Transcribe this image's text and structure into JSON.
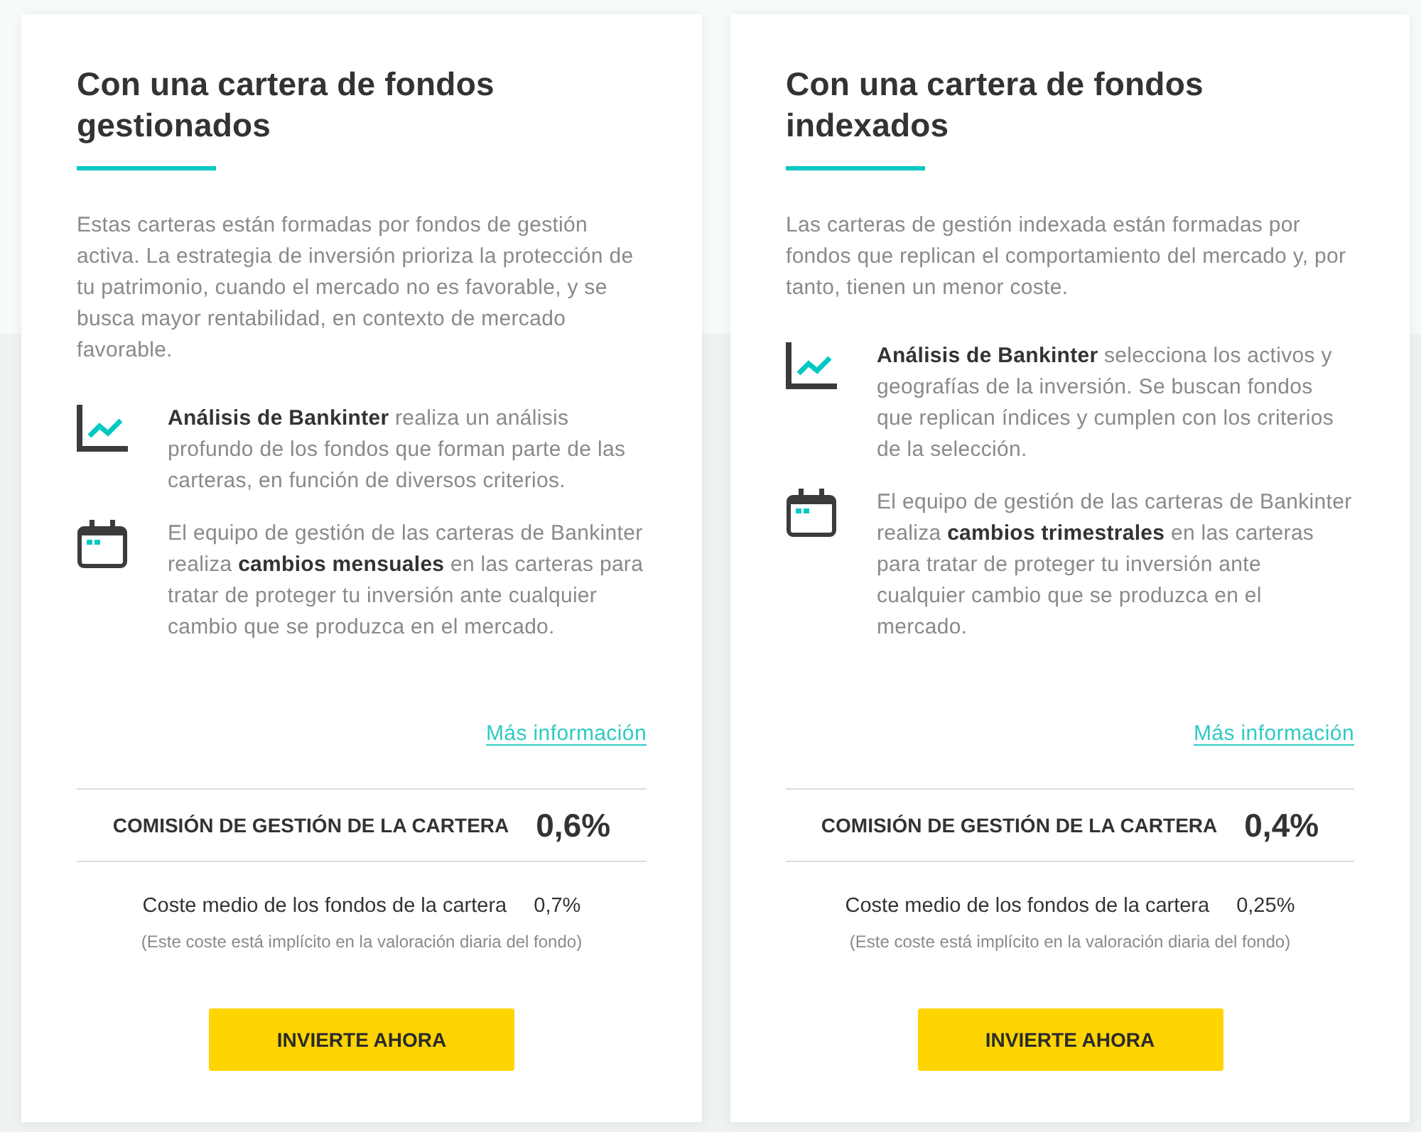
{
  "cards": [
    {
      "title": "Con una cartera de fondos gestionados",
      "description": "Estas carteras están formadas por fondos de gestión activa. La estrategia de inversión prioriza la protección de tu patrimonio, cuando el mercado no es favorable, y se busca mayor rentabilidad, en contexto de mercado favorable.",
      "features": [
        {
          "text": "**Análisis de Bankinter** realiza un análisis profundo de los fondos que forman parte de las carteras, en función de diversos criterios."
        },
        {
          "text": "El equipo de gestión de las carteras de Bankinter realiza **cambios mensuales** en las carteras para tratar de proteger tu inversión ante cualquier cambio que se produzca en el mercado."
        }
      ],
      "link": "Más información",
      "management_fee": {
        "label": "COMISIÓN DE GESTIÓN DE LA CARTERA",
        "value": "0,6%"
      },
      "average_cost": {
        "label": "Coste medio de los fondos de la cartera",
        "value": "0,7%",
        "note": "(Este coste está implícito en la valoración diaria del fondo)"
      },
      "button": "INVIERTE AHORA"
    },
    {
      "title": "Con una cartera de fondos indexados",
      "description": "Las carteras de gestión indexada están formadas por fondos que replican el comportamiento del mercado y, por tanto, tienen un menor coste.",
      "features": [
        {
          "text": "**Análisis de Bankinter** selecciona los activos y geografías de la inversión. Se buscan fondos que replican índices y cumplen con los criterios de la selección."
        },
        {
          "text": "El equipo de gestión de las carteras de Bankinter realiza **cambios trimestrales** en las carteras para tratar de proteger tu inversión ante cualquier cambio que se produzca en el mercado."
        }
      ],
      "link": "Más información",
      "management_fee": {
        "label": "COMISIÓN DE GESTIÓN DE LA CARTERA",
        "value": "0,4%"
      },
      "average_cost": {
        "label": "Coste medio de los fondos de la cartera",
        "value": "0,25%",
        "note": "(Este coste está implícito en la valoración diaria del fondo)"
      },
      "button": "INVIERTE AHORA"
    }
  ]
}
